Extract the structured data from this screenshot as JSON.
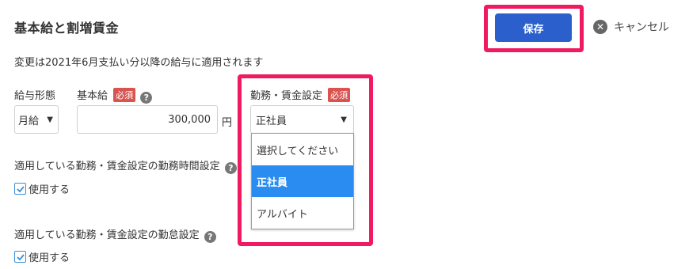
{
  "header": {
    "title": "基本給と割増賃金",
    "save_label": "保存",
    "cancel_label": "キャンセル"
  },
  "notice": "変更は2021年6月支払い分以降の給与に適用されます",
  "form": {
    "pay_type": {
      "label": "給与形態",
      "value": "月給"
    },
    "base_salary": {
      "label": "基本給",
      "required": "必須",
      "value": "300,000",
      "unit": "円"
    },
    "work_wage_setting": {
      "label": "勤務・賃金設定",
      "required": "必須",
      "value": "正社員",
      "options": [
        "選択してください",
        "正社員",
        "アルバイト"
      ],
      "selected_index": 1
    },
    "work_hours_setting": {
      "label": "適用している勤務・賃金設定の勤務時間設定",
      "checkbox_label": "使用する",
      "checked": true
    },
    "attendance_setting": {
      "label": "適用している勤務・賃金設定の勤怠設定",
      "checkbox_label": "使用する",
      "checked": true
    }
  },
  "colors": {
    "primary": "#2b5fcc",
    "required": "#d9534f",
    "highlight": "#ef1a5f",
    "selected_option": "#2a8cf0"
  }
}
